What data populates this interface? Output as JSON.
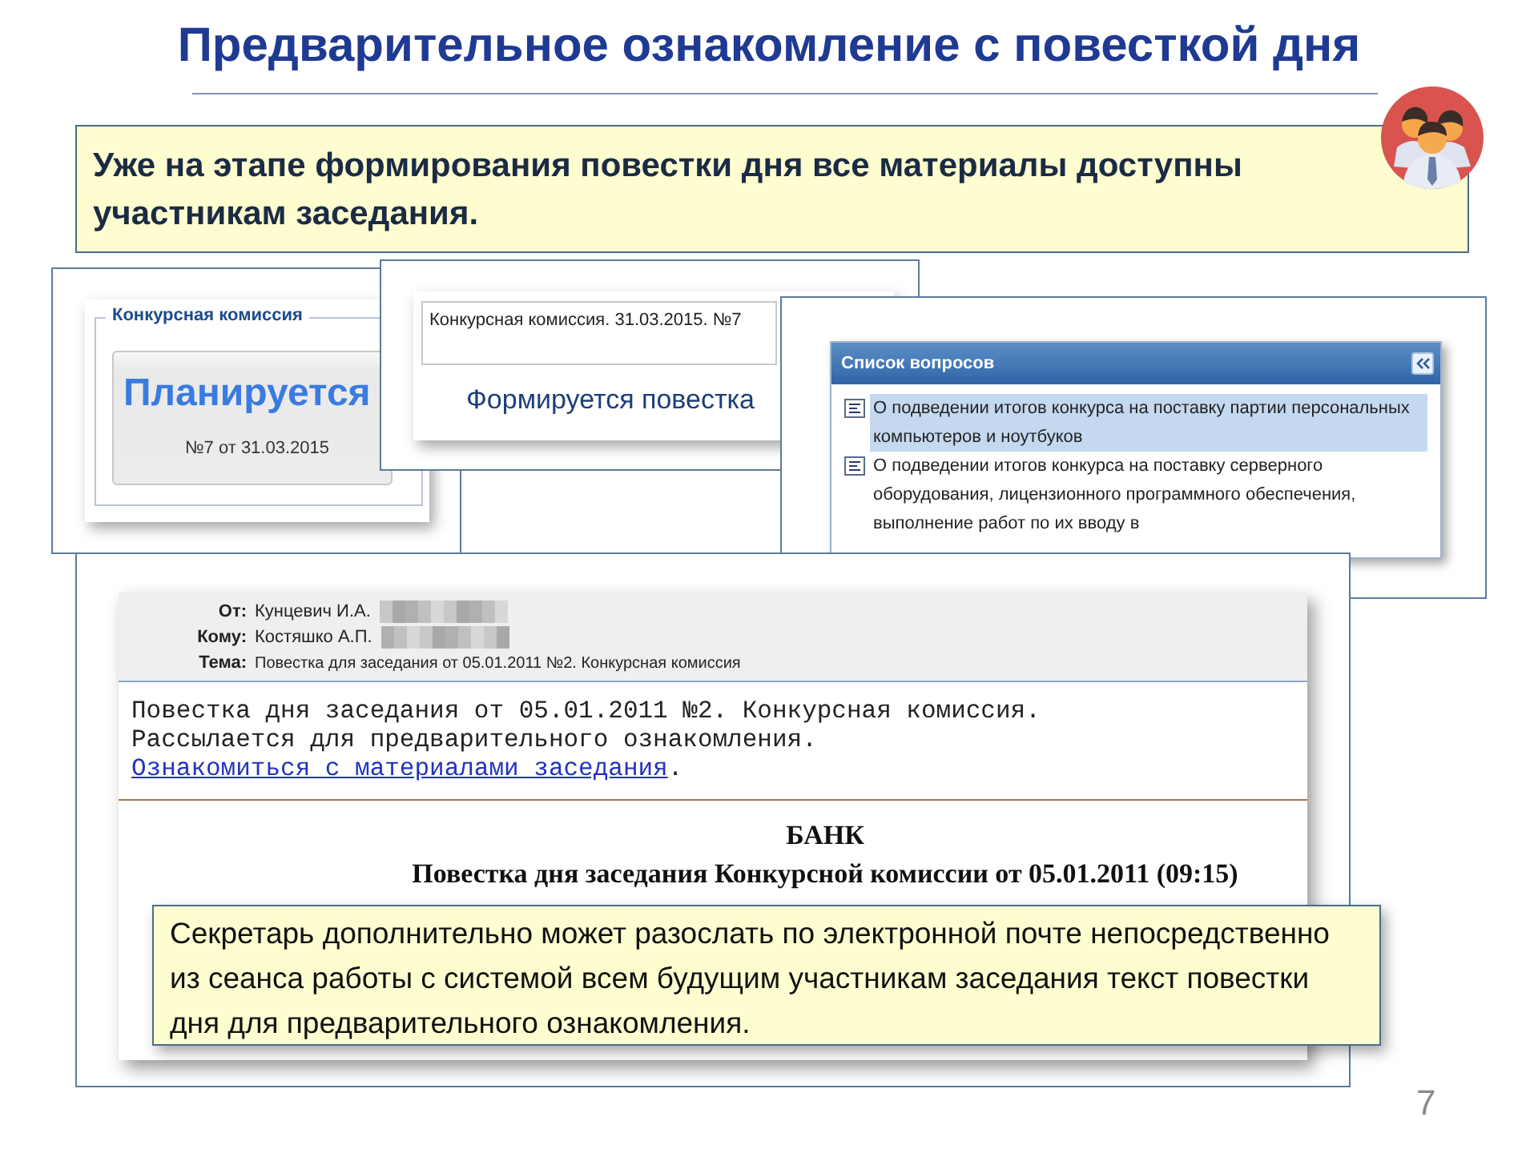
{
  "title": "Предварительное ознакомление с повесткой дня",
  "lead": "Уже на этапе формирования повестки дня все материалы доступны участникам заседания.",
  "status_card": {
    "legend": "Конкурсная комиссия",
    "status": "Планируется",
    "number": "№7 от 31.03.2015"
  },
  "agenda_card": {
    "field_value": "Конкурсная комиссия. 31.03.2015. №7",
    "status": "Формируется повестка"
  },
  "question_list": {
    "title": "Список вопросов",
    "items": [
      {
        "text": "О подведении итогов конкурса на поставку партии персональных компьютеров и ноутбуков",
        "selected": true
      },
      {
        "text": "О подведении итогов конкурса на поставку серверного оборудования, лицензионного программного обеспечения, выполнение работ по их вводу в",
        "selected": false
      }
    ]
  },
  "email": {
    "headers": [
      {
        "label": "От:",
        "value": "Кунцевич И.А.",
        "redacted": true
      },
      {
        "label": "Кому:",
        "value": "Костяшко А.П.",
        "redacted": true
      },
      {
        "label": "Тема:",
        "value": "Повестка для заседания от 05.01.2011 №2. Конкурсная комиссия",
        "redacted": false
      }
    ],
    "body": [
      "Повестка дня заседания от 05.01.2011 №2. Конкурсная комиссия.",
      "Рассылается для предварительного ознакомления."
    ],
    "link": "Ознакомиться с материалами заседания",
    "link_tail": ".",
    "org": "БАНК",
    "heading": "Повестка дня заседания Конкурсной комиссии от 05.01.2011 (09:15)"
  },
  "note": "Секретарь дополнительно может разослать по электронной почте непосредственно из сеанса работы с системой всем будущим участникам заседания текст повестки дня для предварительного ознакомления.",
  "page_number": "7"
}
